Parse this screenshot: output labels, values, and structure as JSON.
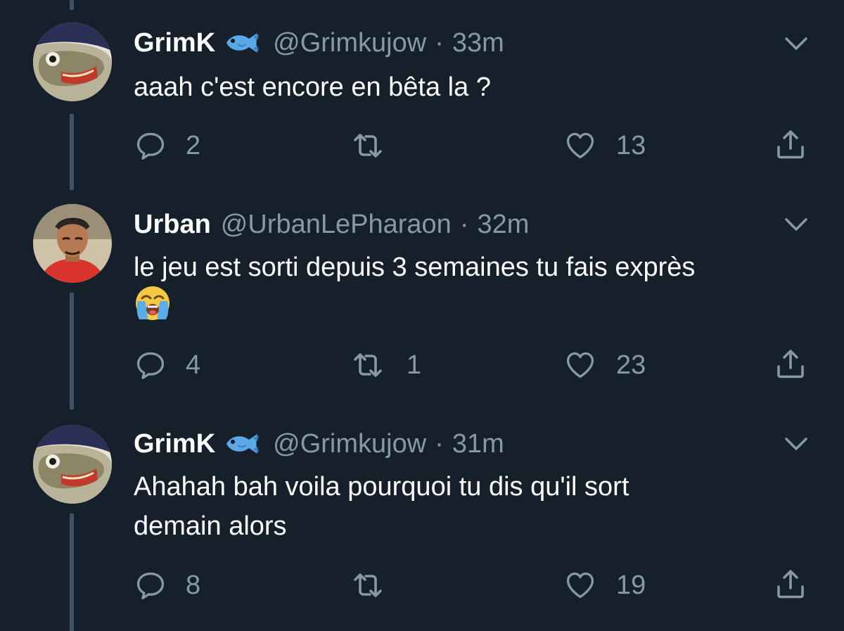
{
  "tweets": [
    {
      "name": "GrimK",
      "badge_icon": "fish-emoji-icon",
      "handle": "@Grimkujow",
      "separator": "·",
      "time": "33m",
      "text": "aaah c'est encore en bêta la ?",
      "replies": "2",
      "retweets": "",
      "likes": "13"
    },
    {
      "name": "Urban",
      "badge_icon": "",
      "handle": "@UrbanLePharaon",
      "separator": "·",
      "time": "32m",
      "text": "le jeu est sorti depuis 3 semaines tu fais exprès",
      "emoji_icon": "loudly-crying-face-emoji-icon",
      "replies": "4",
      "retweets": "1",
      "likes": "23"
    },
    {
      "name": "GrimK",
      "badge_icon": "fish-emoji-icon",
      "handle": "@Grimkujow",
      "separator": "·",
      "time": "31m",
      "text_line1": "Ahahah bah voila pourquoi tu dis qu'il sort",
      "text_line2": "demain alors",
      "replies": "8",
      "retweets": "",
      "likes": "19"
    }
  ],
  "colors": {
    "background": "#15202b",
    "text": "#ffffff",
    "secondary": "#8899a6",
    "thread_line": "#3d5466"
  }
}
